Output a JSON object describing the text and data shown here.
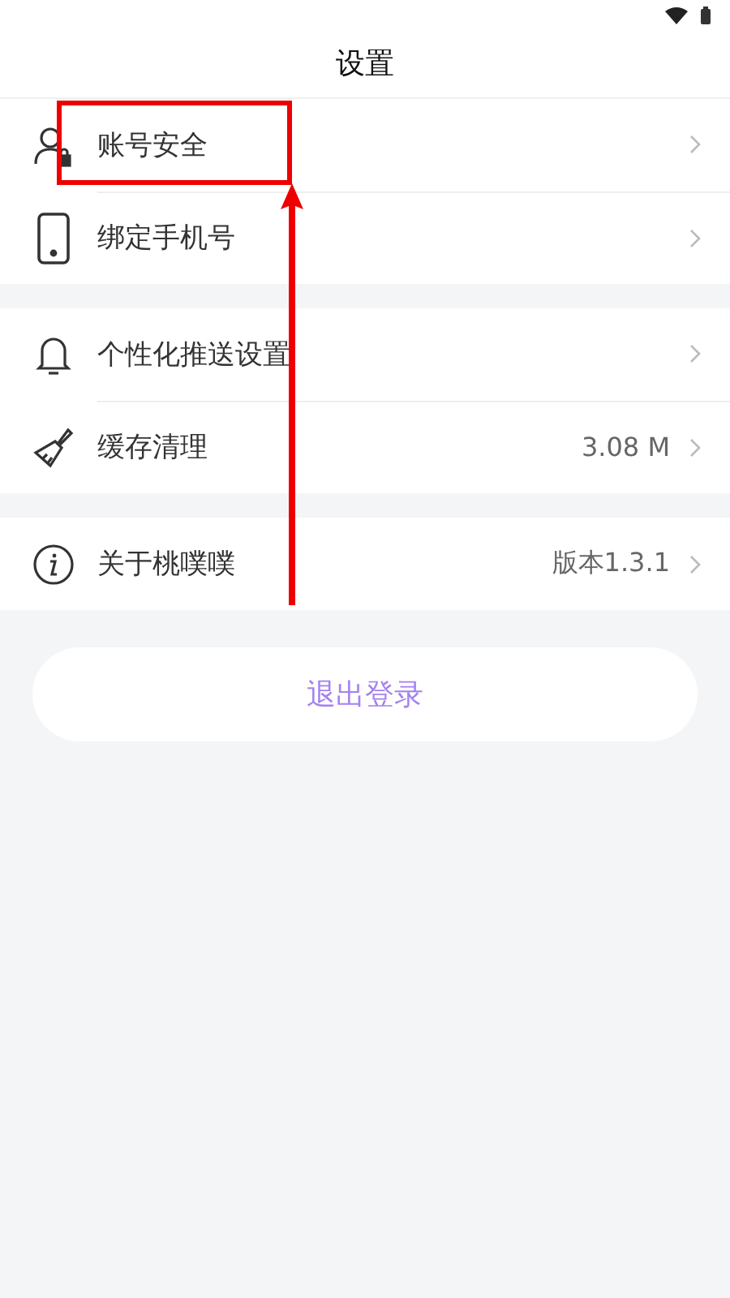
{
  "header": {
    "title": "设置"
  },
  "groups": [
    {
      "items": [
        {
          "label": "账号安全"
        },
        {
          "label": "绑定手机号"
        }
      ]
    },
    {
      "items": [
        {
          "label": "个性化推送设置"
        },
        {
          "label": "缓存清理",
          "value": "3.08 M"
        }
      ]
    },
    {
      "items": [
        {
          "label": "关于桃噗噗",
          "value": "版本1.3.1"
        }
      ]
    }
  ],
  "logout_button": "退出登录"
}
